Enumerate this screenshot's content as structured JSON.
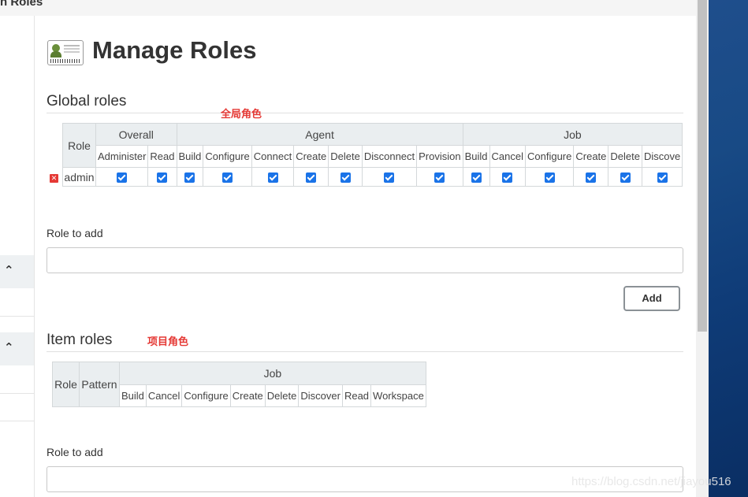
{
  "window": {
    "title": "n Roles"
  },
  "page": {
    "title": "Manage Roles",
    "icon": "id-card-icon"
  },
  "global_roles": {
    "title": "Global roles",
    "annotation": "全局角色",
    "role_header": "Role",
    "groups": [
      {
        "name": "Overall",
        "permissions": [
          "Administer",
          "Read"
        ]
      },
      {
        "name": "Agent",
        "permissions": [
          "Build",
          "Configure",
          "Connect",
          "Create",
          "Delete",
          "Disconnect",
          "Provision"
        ]
      },
      {
        "name": "Job",
        "permissions": [
          "Build",
          "Cancel",
          "Configure",
          "Create",
          "Delete",
          "Discove"
        ]
      }
    ],
    "rows": [
      {
        "role": "admin",
        "checked": [
          true,
          true,
          true,
          true,
          true,
          true,
          true,
          true,
          true,
          true,
          true,
          true,
          true,
          true,
          true
        ]
      }
    ],
    "role_to_add_label": "Role to add",
    "role_to_add_value": "",
    "add_button": "Add"
  },
  "item_roles": {
    "title": "Item roles",
    "annotation": "项目角色",
    "role_header": "Role",
    "pattern_header": "Pattern",
    "group": "Job",
    "permissions": [
      "Build",
      "Cancel",
      "Configure",
      "Create",
      "Delete",
      "Discover",
      "Read",
      "Workspace"
    ],
    "role_to_add_label": "Role to add",
    "role_to_add_value": ""
  },
  "sidebar": {
    "collapse_icons": [
      "chevron-up-icon",
      "chevron-up-icon"
    ]
  },
  "watermark": "https://blog.csdn.net/jiayou516",
  "colors": {
    "annotation": "#e53935",
    "checkbox": "#1a73e8",
    "header_bg": "#eaeef0"
  }
}
